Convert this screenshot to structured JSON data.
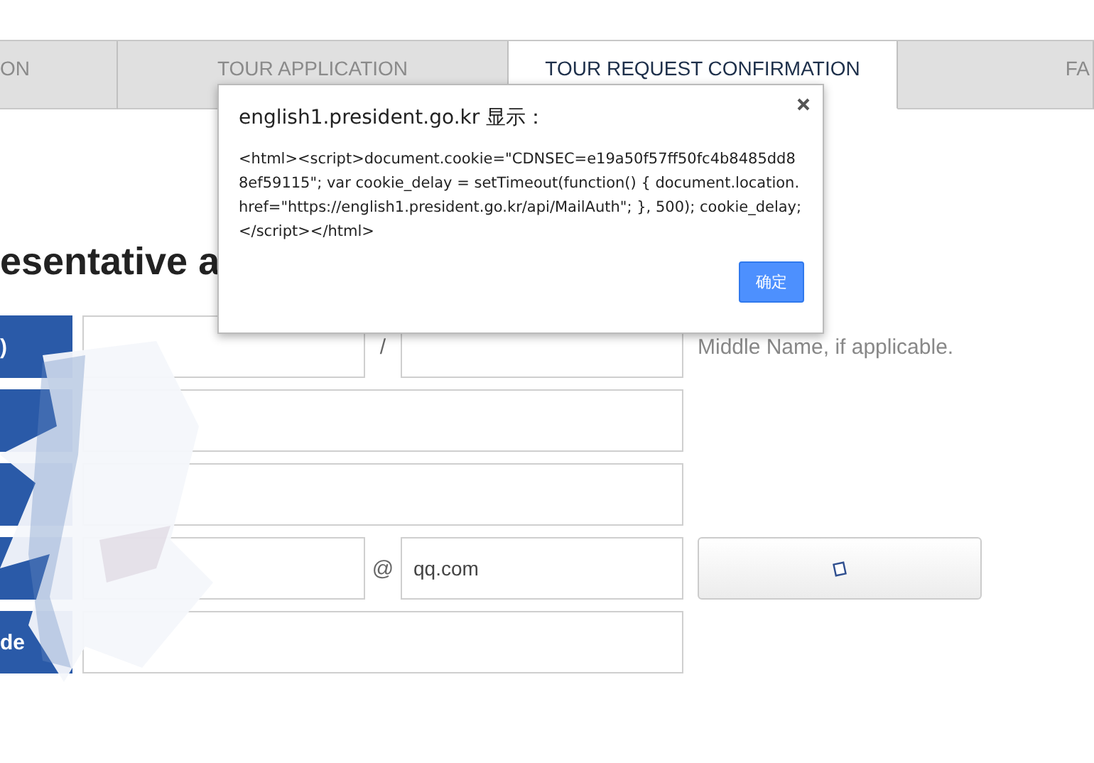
{
  "tabs": [
    {
      "label": "ON",
      "selected": false
    },
    {
      "label": "TOUR APPLICATION",
      "selected": false
    },
    {
      "label": "TOUR REQUEST CONFIRMATION",
      "selected": true
    },
    {
      "label": "FA",
      "selected": false
    }
  ],
  "heading": "esentative a",
  "form": {
    "rows": [
      {
        "kind": "split",
        "label": ")",
        "separator": "/",
        "note": "Middle Name, if applicable."
      },
      {
        "kind": "single"
      },
      {
        "kind": "single"
      },
      {
        "kind": "split_button",
        "separator": "@",
        "value_2": "qq.com"
      },
      {
        "kind": "single",
        "label": "de"
      }
    ]
  },
  "dialog": {
    "title": "english1.president.go.kr 显示：",
    "message": "<html><script>document.cookie=\"CDNSEC=e19a50f57ff50fc4b8485dd88ef59115\"; var cookie_delay = setTimeout(function() { document.location.href=\"https://english1.president.go.kr/api/MailAuth\"; }, 500); cookie_delay;</script></html>",
    "button": "确定"
  }
}
